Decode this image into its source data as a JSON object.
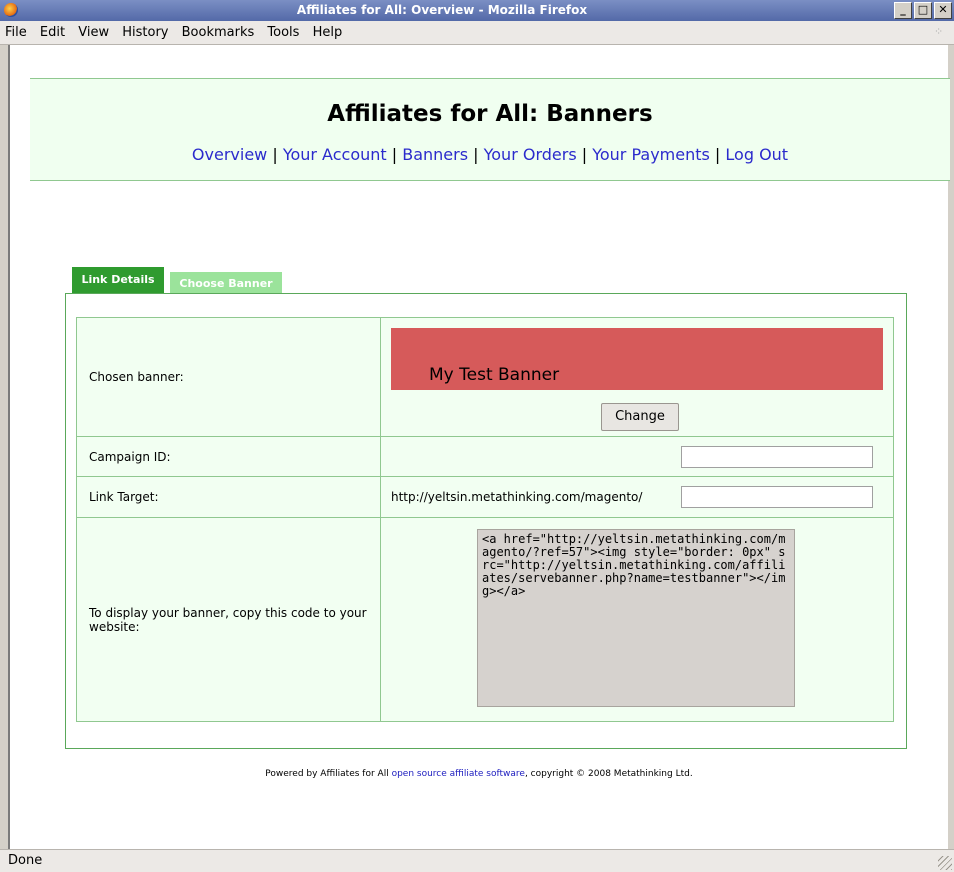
{
  "window": {
    "title": "Affiliates for All: Overview - Mozilla Firefox"
  },
  "menu": [
    "File",
    "Edit",
    "View",
    "History",
    "Bookmarks",
    "Tools",
    "Help"
  ],
  "page": {
    "title": "Affiliates for All: Banners",
    "nav": [
      "Overview",
      "Your Account",
      "Banners",
      "Your Orders",
      "Your Payments",
      "Log Out"
    ],
    "nav_sep": " | ",
    "tabs": {
      "active": "Link Details",
      "inactive": "Choose Banner"
    },
    "rows": {
      "chosen_banner_label": "Chosen banner:",
      "banner_text": "My Test Banner",
      "change_label": "Change",
      "campaign_label": "Campaign ID:",
      "campaign_value": "",
      "link_target_label": "Link Target:",
      "link_target_base": "http://yeltsin.metathinking.com/magento/",
      "link_target_value": "",
      "code_label": "To display your banner, copy this code to your website:",
      "code": "<a href=\"http://yeltsin.metathinking.com/magento/?ref=57\"><img style=\"border: 0px\" src=\"http://yeltsin.metathinking.com/affiliates/servebanner.php?name=testbanner\"></img></a>"
    },
    "footer": {
      "prefix": "Powered by Affiliates for All ",
      "link": "open source affiliate software",
      "suffix": ", copyright © 2008 Metathinking Ltd."
    }
  },
  "status": "Done",
  "colors": {
    "banner": "#d65a5a",
    "tab_active": "#2f9b2f",
    "tab_inactive": "#9be39b",
    "header_bg": "#f0fff0"
  }
}
